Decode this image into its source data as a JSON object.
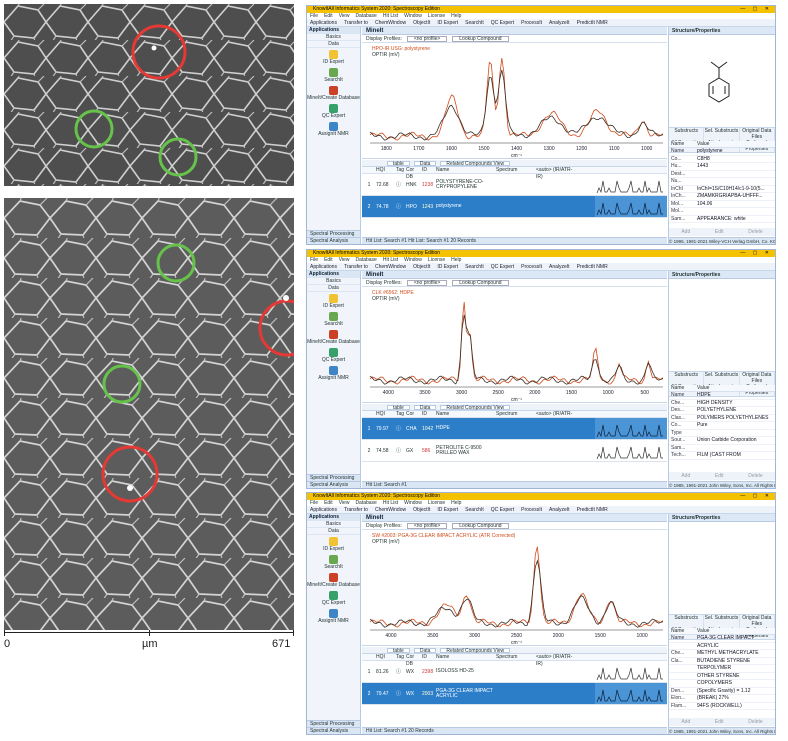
{
  "micrographs": {
    "scalebar": {
      "start": "0",
      "unit": "µm",
      "end": "671"
    }
  },
  "apptitle": "KnowItAll Informatics System 2020: Spectroscopy Edition",
  "menu": [
    "File",
    "Edit",
    "View",
    "Database",
    "Hit List",
    "Window",
    "License",
    "Help"
  ],
  "toolbar": [
    "Applications",
    "Transfer to",
    "ChemWindow",
    "ObjectIt",
    "ID Expert",
    "SearchIt",
    "QC Expert",
    "ProcessIt",
    "AnalyzeIt",
    "PredictIt NMR"
  ],
  "sidebar": {
    "header": "Applications",
    "rows": [
      "Basics",
      "Data"
    ],
    "tools": [
      "ID Expert",
      "SearchIt",
      "MineIt/Create Database",
      "QC Expert",
      "AssignIt NMR"
    ],
    "foot1": "Spectral Processing",
    "foot2": "Spectral Analysis"
  },
  "common": {
    "display_profiles": "Display Profiles:",
    "no_profile": "<no profile>",
    "lookup": "Lookup Compound",
    "table_tab": "table",
    "data_tab": "Data",
    "related_tab": "Related Compounds View",
    "col_hqi": "HQI",
    "col_tag": "Tag",
    "col_cor": "Cor DB",
    "col_id": "ID",
    "col_name": "Name",
    "col_spectrum": "Spectrum",
    "col_auto": "<auto> (IR/ATR-IR)",
    "xunit": "cm⁻¹",
    "structure_props": "Structure/Properties",
    "ptabs": [
      "Substructs",
      "Sel. Substructs",
      "Original Data Files",
      "All Properties",
      "Attachments",
      "Preferred Properties"
    ],
    "ph_name": "Name",
    "ph_value": "Value",
    "pbtns": [
      "Add",
      "Edit",
      "Delete"
    ]
  },
  "panels": [
    {
      "title": "MineIt",
      "legend1": "HPO-IR USG: polystyrene",
      "legend2": "OPTIR (mV)",
      "ticks": [
        "1800",
        "1700",
        "1600",
        "1500",
        "1400",
        "1300",
        "1200",
        "1100",
        "1000"
      ],
      "results": [
        {
          "num": "1",
          "hqi": "72.68",
          "tag": "",
          "db": "HNK",
          "id": "1238",
          "name": "POLYSTYRENE-CO-CRYPROPYLENE"
        },
        {
          "num": "2",
          "hqi": "74.78",
          "tag": "",
          "db": "HPO",
          "id": "1243",
          "name": "polystyrene"
        }
      ],
      "status": "Hit List: Search #1   Hit List: Search #1   20 Records",
      "props": [
        [
          "Name",
          "polystyrene"
        ],
        [
          "Co...",
          "C8H8"
        ],
        [
          "Hu...",
          "1443"
        ],
        [
          "Dest...",
          ""
        ],
        [
          "Nu...",
          ""
        ],
        [
          "InChI",
          "InChI=1S/C10H14/c1-9-10(5..."
        ],
        [
          "InCh...",
          "ZMAMKRGRIAPBA-UHFFF..."
        ],
        [
          "Mol...",
          "104.06"
        ],
        [
          "Mol...",
          ""
        ],
        [
          "Sam...",
          "APPEARANCE: white"
        ]
      ],
      "copyright": "© 1995, 1991-2021 Wiley-VCH Verlag GmbH, Co. KGaA. All Rights Reserved."
    },
    {
      "title": "MineIt",
      "legend1": "CLK #6562: HDPE",
      "legend2": "OPTIR (mV)",
      "ticks": [
        "4000",
        "3500",
        "3000",
        "2500",
        "2000",
        "1500",
        "1000",
        "500"
      ],
      "results": [
        {
          "num": "1",
          "hqi": "79.97",
          "tag": "",
          "db": "CHA",
          "id": "1042",
          "name": "HDPE"
        },
        {
          "num": "2",
          "hqi": "74.58",
          "tag": "",
          "db": "GX",
          "id": "586",
          "name": "PETROLITE C-9500 PRILLED WAX"
        }
      ],
      "status": "Hit List: Search #1",
      "props": [
        [
          "Name",
          "HDPE"
        ],
        [
          "Che...",
          "HIGH DENSITY"
        ],
        [
          "Des...",
          "POLYETHYLENE"
        ],
        [
          "Clas...",
          "POLYMERS  POLYETHYLENES"
        ],
        [
          "Co...",
          "Pure"
        ],
        [
          "Type",
          ""
        ],
        [
          "Sour...",
          "Union Carbide Corporation"
        ],
        [
          "Sam...",
          ""
        ],
        [
          "Tech...",
          "FILM (CAST FROM"
        ]
      ],
      "copyright": "© 1985, 1991-2021 John Wiley, Sons, Inc. All Rights Reserved."
    },
    {
      "title": "MineIt",
      "legend1": "SW #2003: PGA-3G CLEAR IMPACT ACRYLIC (ATR Corrected)",
      "legend2": "OPTIR (mV)",
      "ticks": [
        "4000",
        "3500",
        "3000",
        "2500",
        "2000",
        "1500",
        "1000"
      ],
      "results": [
        {
          "num": "1",
          "hqi": "81.26",
          "tag": "",
          "db": "WX",
          "id": "2398",
          "name": "ISOLOSS HD-25"
        },
        {
          "num": "2",
          "hqi": "79.47",
          "tag": "",
          "db": "WX",
          "id": "2003",
          "name": "PGA-3G CLEAR IMPACT ACRYLIC"
        }
      ],
      "status": "Hit List: Search #1   20 Records",
      "props": [
        [
          "Name",
          "PGA-3G CLEAR IMPACT"
        ],
        [
          "",
          "ACRYLIC"
        ],
        [
          "Che...",
          "METHYL METHACRYLATE"
        ],
        [
          "Cla...",
          "BUTADIENE STYRENE"
        ],
        [
          "",
          "TERPOLYMER"
        ],
        [
          "",
          "OTHER STYRENE"
        ],
        [
          "",
          "COPOLYMERS"
        ],
        [
          "Den...",
          "(Specific Gravity) = 1.12"
        ],
        [
          "Elon...",
          "(BREAK) 27%"
        ],
        [
          "Flam...",
          "94FS (ROCKWELL)"
        ]
      ],
      "copyright": "© 1985, 1991-2021 John Wiley, Sons, Inc. All Rights Reserved."
    }
  ]
}
